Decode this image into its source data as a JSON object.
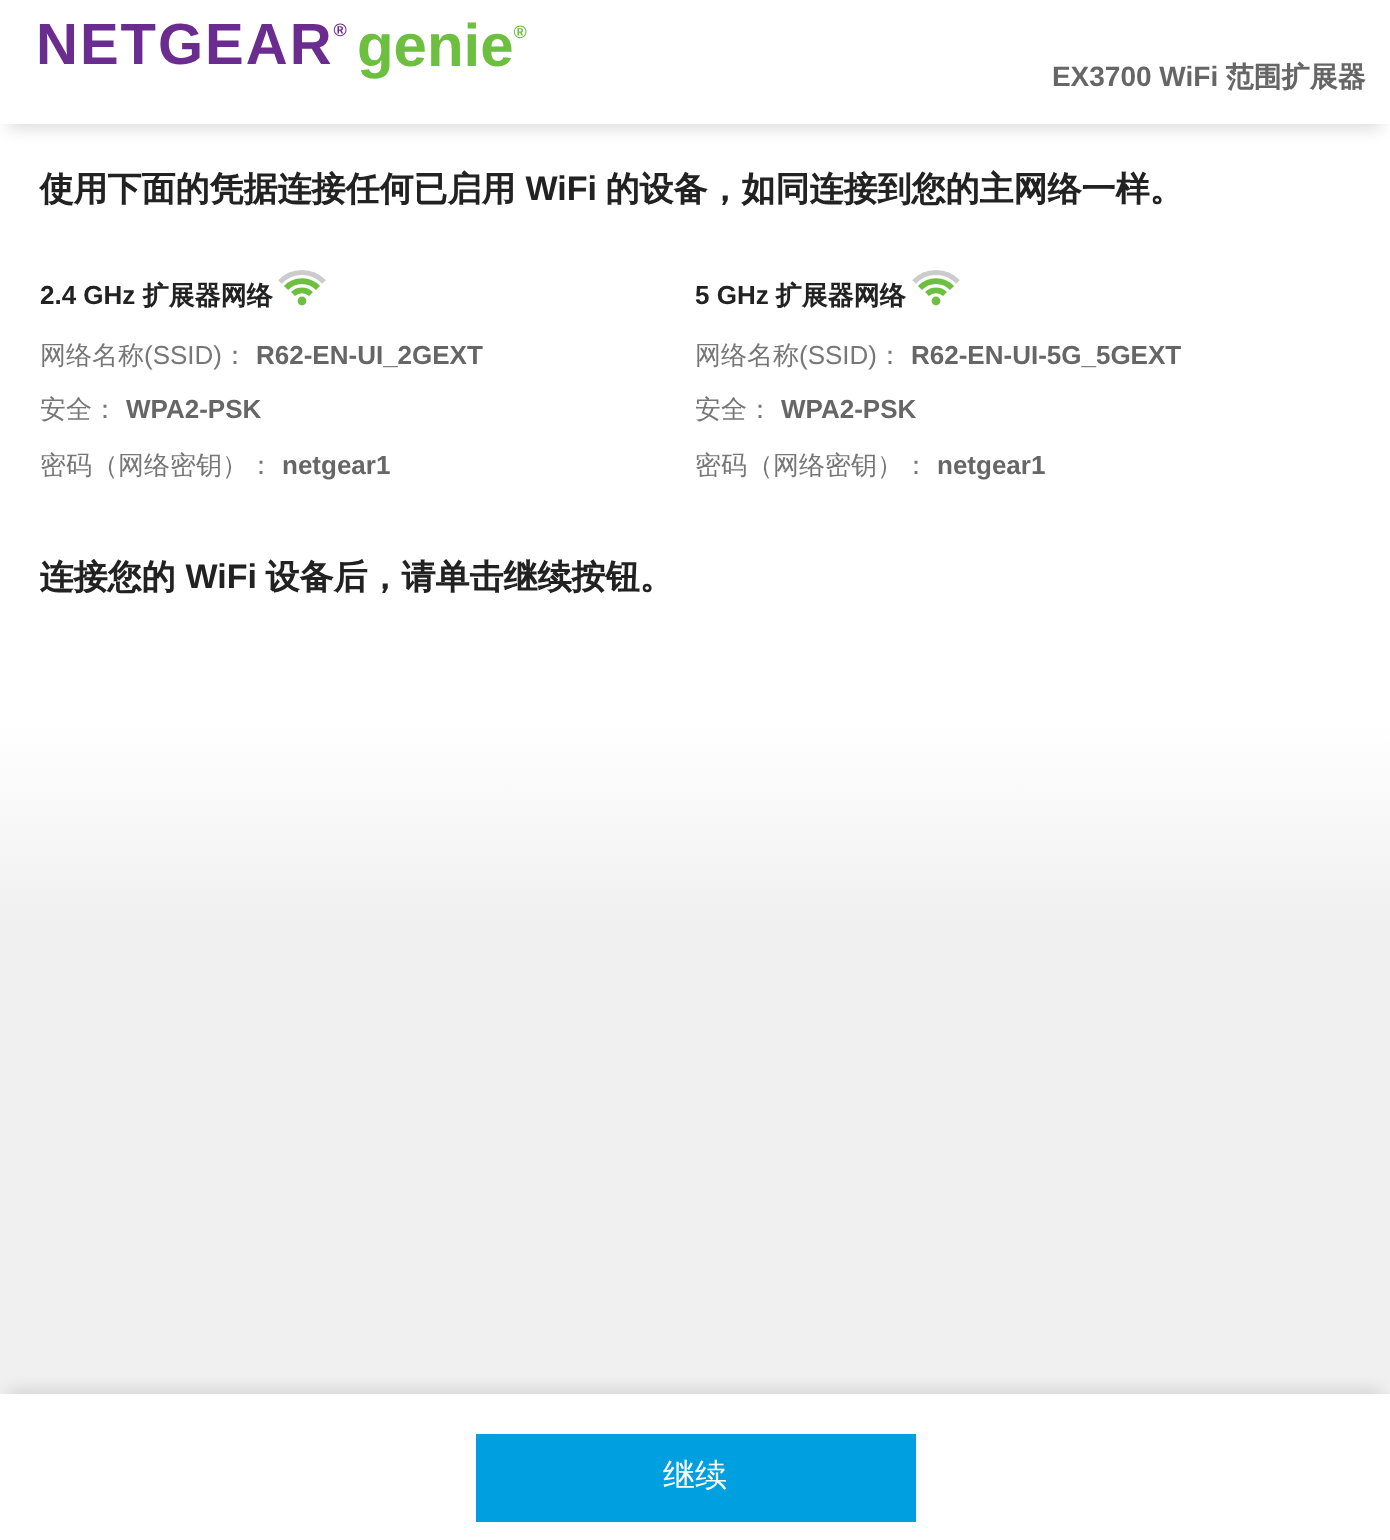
{
  "header": {
    "logo_brand": "NETGEAR$^{®}$",
    "logo_product": "genie$^{®}$",
    "device_title": "EX3700 WiFi 范围扩展器"
  },
  "intro": "使用下面的凭据连接任何已启用 WiFi 的设备，如同连接到您的主网络一样。",
  "networks": [
    {
      "title": "2.4 GHz 扩展器网络",
      "fields": [
        {
          "label": "网络名称(SSID)：",
          "value": "R62-EN-UI_2GEXT"
        },
        {
          "label": "安全：",
          "value": "WPA2-PSK"
        },
        {
          "label": "密码（网络密钥）：",
          "value": "netgear1"
        }
      ]
    },
    {
      "title": "5 GHz 扩展器网络",
      "fields": [
        {
          "label": "网络名称(SSID)：",
          "value": "R62-EN-UI-5G_5GEXT"
        },
        {
          "label": "安全：",
          "value": "WPA2-PSK"
        },
        {
          "label": "密码（网络密钥）：",
          "value": "netgear1"
        }
      ]
    }
  ],
  "instruction": "连接您的 WiFi 设备后，请单击继续按钮。",
  "continue_button": "继续"
}
